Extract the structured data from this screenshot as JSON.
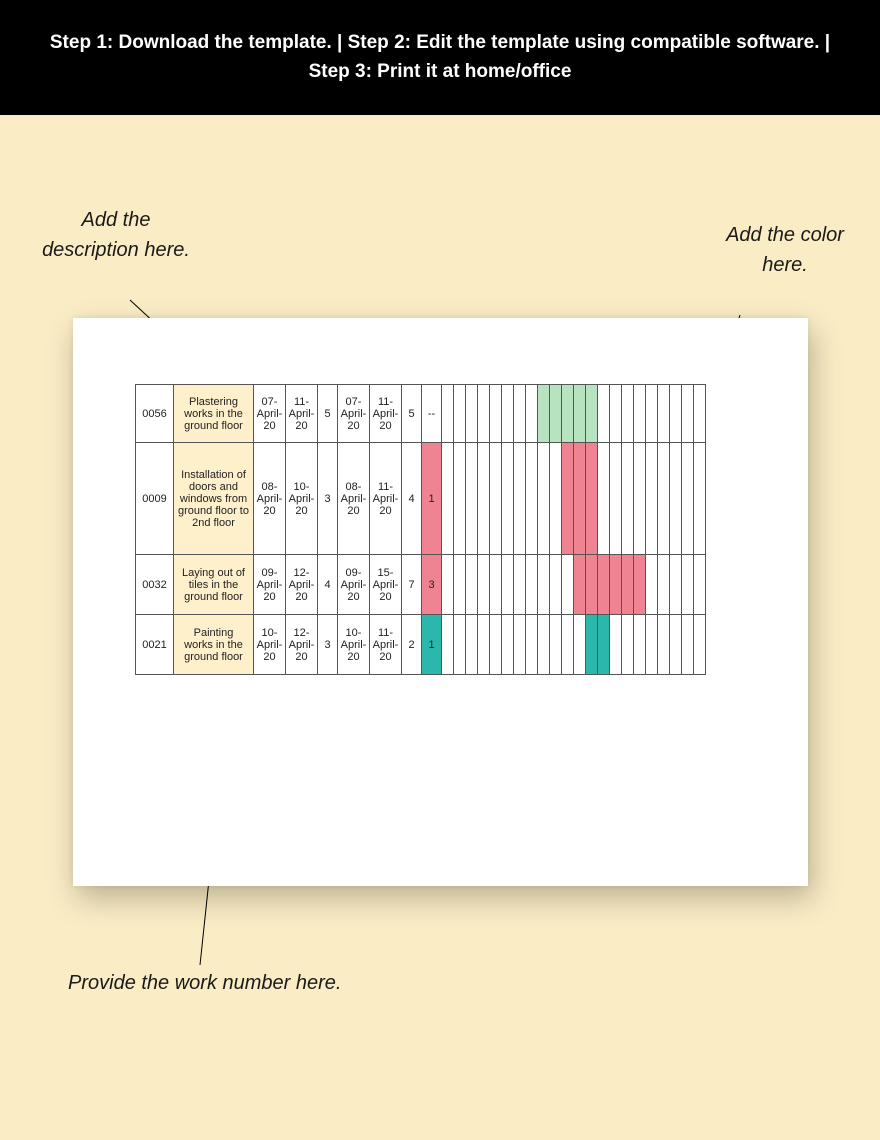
{
  "topbar": {
    "text": "Step 1: Download the template.    |    Step 2: Edit the template using compatible software.   |    Step 3: Print it at home/office"
  },
  "callouts": {
    "desc": "Add the description here.",
    "color": "Add the color here.",
    "worknum": "Provide the work number here."
  },
  "gantt": {
    "barSlots": 22,
    "rows": [
      {
        "id": "0056",
        "desc": "Plastering works in the ground floor",
        "d1": "07-April-20",
        "d2": "11-April-20",
        "n1": "5",
        "d3": "07-April-20",
        "d4": "11-April-20",
        "n2": "5",
        "n3": "--",
        "bars": [
          {
            "from": 9,
            "to": 13,
            "cls": "g-green"
          }
        ],
        "rowCls": "row-h1"
      },
      {
        "id": "0009",
        "desc": "Installation of doors and windows from ground floor to 2nd floor",
        "d1": "08-April-20",
        "d2": "10-April-20",
        "n1": "3",
        "d3": "08-April-20",
        "d4": "11-April-20",
        "n2": "4",
        "n3": "1",
        "bars": [
          {
            "from": 0,
            "to": 0,
            "cls": "g-red"
          },
          {
            "from": 11,
            "to": 13,
            "cls": "g-red"
          }
        ],
        "rowCls": "row-h2"
      },
      {
        "id": "0032",
        "desc": "Laying out of tiles in the ground floor",
        "d1": "09-April-20",
        "d2": "12-April-20",
        "n1": "4",
        "d3": "09-April-20",
        "d4": "15-April-20",
        "n2": "7",
        "n3": "3",
        "bars": [
          {
            "from": 0,
            "to": 0,
            "cls": "g-red"
          },
          {
            "from": 12,
            "to": 17,
            "cls": "g-red"
          }
        ],
        "rowCls": "row-h3"
      },
      {
        "id": "0021",
        "desc": "Painting works in the ground floor",
        "d1": "10-April-20",
        "d2": "12-April-20",
        "n1": "3",
        "d3": "10-April-20",
        "d4": "11-April-20",
        "n2": "2",
        "n3": "1",
        "bars": [
          {
            "from": 0,
            "to": 0,
            "cls": "g-teal"
          },
          {
            "from": 13,
            "to": 14,
            "cls": "g-teal"
          }
        ],
        "rowCls": "row-h4"
      }
    ]
  }
}
